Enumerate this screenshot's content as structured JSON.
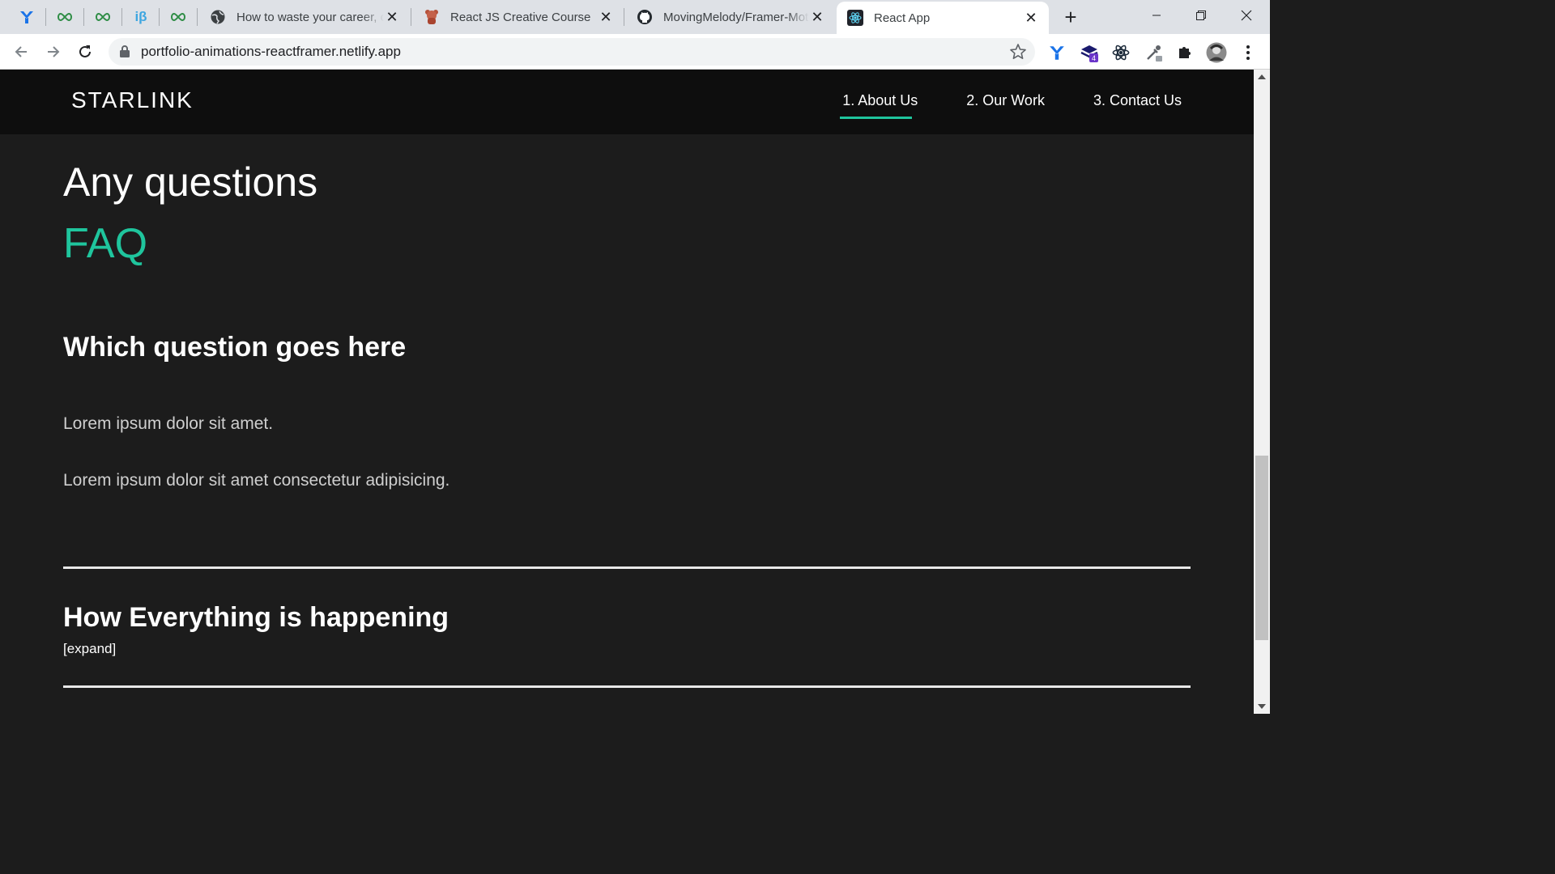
{
  "browser": {
    "pinned_tabs": [
      {
        "icon": "y-logo-icon"
      },
      {
        "icon": "infinity-icon"
      },
      {
        "icon": "infinity-icon"
      },
      {
        "icon": "ib-icon",
        "label": "iβ"
      },
      {
        "icon": "infinity-icon"
      }
    ],
    "tabs": [
      {
        "title": "How to waste your career, o",
        "icon": "globe-icon",
        "active": false
      },
      {
        "title": "React JS Creative Course",
        "icon": "bear-icon",
        "active": false
      },
      {
        "title": "MovingMelody/Framer-Mot",
        "icon": "github-icon",
        "active": false
      },
      {
        "title": "React App",
        "icon": "react-icon",
        "active": true
      }
    ],
    "url": "portfolio-animations-reactframer.netlify.app",
    "extensions": [
      {
        "icon": "y-logo-icon"
      },
      {
        "icon": "stack-icon",
        "badge": "4"
      },
      {
        "icon": "react-devtools-icon"
      },
      {
        "icon": "eyedropper-icon"
      },
      {
        "icon": "puzzle-icon"
      },
      {
        "icon": "avatar"
      }
    ]
  },
  "site": {
    "logo": "STARLINK",
    "nav": [
      {
        "label": "1. About Us",
        "active": true
      },
      {
        "label": "2. Our Work",
        "active": false
      },
      {
        "label": "3. Contact Us",
        "active": false
      }
    ],
    "heading": "Any questions",
    "subheading": "FAQ",
    "faqs": [
      {
        "question": "Which question goes here",
        "answers": [
          "Lorem ipsum dolor sit amet.",
          "Lorem ipsum dolor sit amet consectetur adipisicing."
        ]
      },
      {
        "question": "How Everything is happening",
        "toggle": "[expand]"
      }
    ]
  },
  "colors": {
    "accent": "#1fc59d",
    "page_bg": "#1c1c1c",
    "nav_bg": "#0e0e0e"
  }
}
